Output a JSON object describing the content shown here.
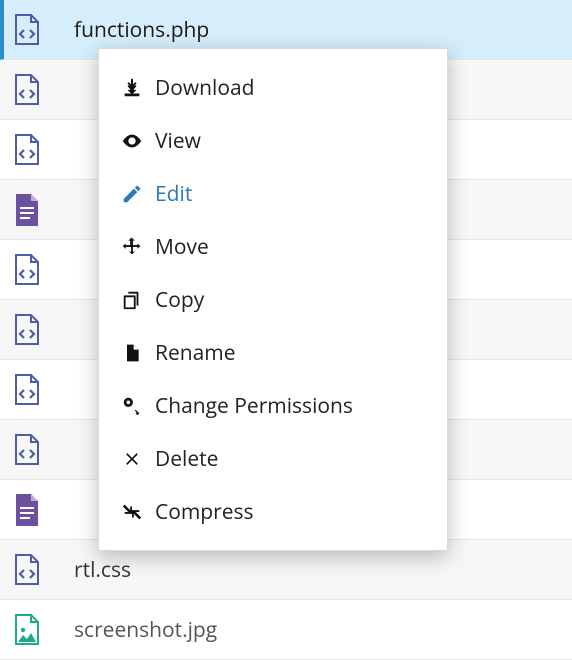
{
  "files": [
    {
      "name": "functions.php",
      "iconColor": "#4b5dab",
      "iconType": "code",
      "selected": true
    },
    {
      "name": "",
      "iconColor": "#4b5dab",
      "iconType": "code"
    },
    {
      "name": "",
      "iconColor": "#4b5dab",
      "iconType": "code"
    },
    {
      "name": "",
      "iconColor": "#6b519e",
      "iconType": "doc"
    },
    {
      "name": "",
      "iconColor": "#4b5dab",
      "iconType": "code"
    },
    {
      "name": "",
      "iconColor": "#4b5dab",
      "iconType": "code"
    },
    {
      "name": "",
      "iconColor": "#4b5dab",
      "iconType": "code"
    },
    {
      "name": "",
      "iconColor": "#4b5dab",
      "iconType": "code"
    },
    {
      "name": "",
      "iconColor": "#6b519e",
      "iconType": "doc"
    },
    {
      "name": "rtl.css",
      "iconColor": "#4b5dab",
      "iconType": "code"
    },
    {
      "name": "screenshot.jpg",
      "iconColor": "#1faa8f",
      "iconType": "image"
    }
  ],
  "contextMenu": {
    "items": [
      {
        "label": "Download",
        "icon": "download"
      },
      {
        "label": "View",
        "icon": "view"
      },
      {
        "label": "Edit",
        "icon": "edit",
        "hovered": true
      },
      {
        "label": "Move",
        "icon": "move"
      },
      {
        "label": "Copy",
        "icon": "copy"
      },
      {
        "label": "Rename",
        "icon": "rename"
      },
      {
        "label": "Change Permissions",
        "icon": "permissions"
      },
      {
        "label": "Delete",
        "icon": "delete"
      },
      {
        "label": "Compress",
        "icon": "compress"
      }
    ]
  }
}
